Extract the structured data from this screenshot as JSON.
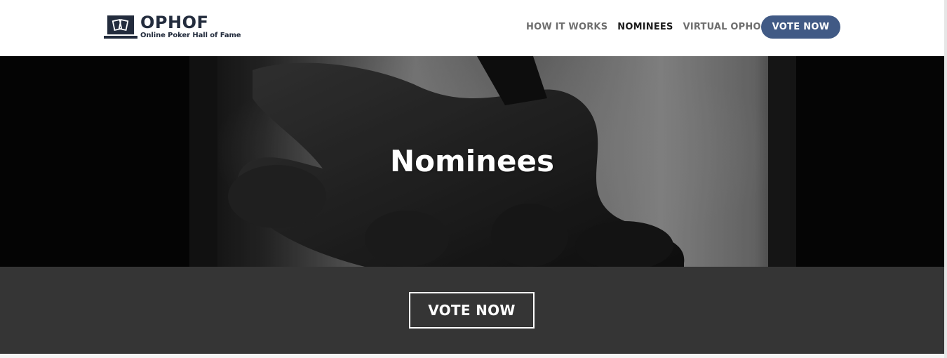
{
  "brand": {
    "title": "OPHOF",
    "subtitle": "Online Poker Hall of Fame",
    "color": "#232c3d"
  },
  "nav": {
    "items": [
      {
        "label": "HOW IT WORKS",
        "active": false
      },
      {
        "label": "NOMINEES",
        "active": true
      },
      {
        "label": "VIRTUAL OPHOF",
        "active": false
      }
    ],
    "cta_label": "VOTE NOW",
    "cta_color": "#415a85"
  },
  "hero": {
    "title": "Nominees"
  },
  "cta_band": {
    "button_label": "VOTE NOW",
    "background": "#353535"
  }
}
